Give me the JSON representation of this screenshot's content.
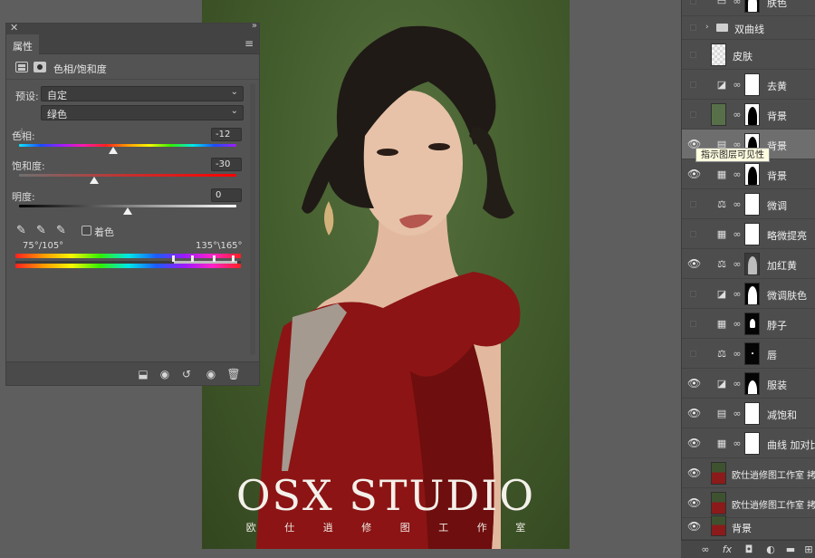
{
  "photo": {
    "studio_title": "OSX STUDIO",
    "studio_subtitle": "欧 仕 逍 修 图 工 作 室"
  },
  "properties": {
    "tab_label": "属性",
    "adjustment_title": "色相/饱和度",
    "preset_label": "预设:",
    "preset_value": "自定",
    "channel_value": "绿色",
    "hue_label": "色相:",
    "hue_value": "-12",
    "saturation_label": "饱和度:",
    "saturation_value": "-30",
    "lightness_label": "明度:",
    "lightness_value": "0",
    "colorize_label": "着色",
    "range_left": "75°/105°",
    "range_right": "135°\\165°"
  },
  "layers": [
    {
      "name": "肤色",
      "visible": false
    },
    {
      "name": "双曲线",
      "visible": false,
      "type": "folder"
    },
    {
      "name": "皮肤",
      "visible": false,
      "type": "pixel"
    },
    {
      "name": "去黄",
      "visible": false
    },
    {
      "name": "背景",
      "visible": false
    },
    {
      "name": "背景",
      "visible": true,
      "selected": true
    },
    {
      "name": "背景",
      "visible": true
    },
    {
      "name": "微调",
      "visible": false
    },
    {
      "name": "略微提亮",
      "visible": false
    },
    {
      "name": "加红黄",
      "visible": true
    },
    {
      "name": "微调肤色",
      "visible": false
    },
    {
      "name": "脖子",
      "visible": false
    },
    {
      "name": "唇",
      "visible": false
    },
    {
      "name": "服装",
      "visible": true
    },
    {
      "name": "减饱和",
      "visible": true
    },
    {
      "name": "曲线 加对比",
      "visible": true
    },
    {
      "name": "欧仕逍修图工作室 拷贝",
      "visible": true
    },
    {
      "name": "欧仕逍修图工作室 拷贝",
      "visible": true
    },
    {
      "name": "背景",
      "visible": true
    }
  ],
  "tooltip": "指示图层可见性",
  "icons": {
    "eye": "eye-icon",
    "link": "link-icon",
    "hue_saturation": "hue-saturation-icon",
    "curves": "curves-icon",
    "color_balance": "color-balance-icon",
    "channel_mixer": "channel-mixer-icon",
    "folder": "folder-icon"
  }
}
